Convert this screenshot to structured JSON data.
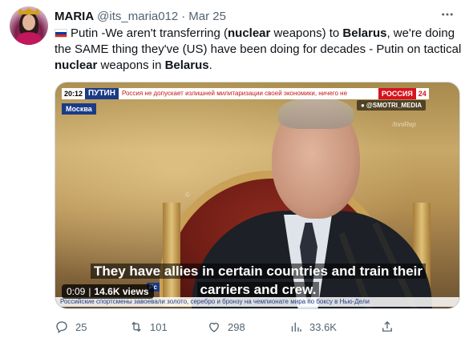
{
  "author": {
    "name": "MARIA",
    "handle": "@its_maria012",
    "separator": "·",
    "date": "Mar 25"
  },
  "tweet": {
    "flag_icon": "russian-flag-icon",
    "segments": [
      "Putin -We aren't transferring (",
      "nuclear",
      " weapons) to ",
      "Belarus",
      ", we're doing the SAME thing they've (US) have been doing for decades - Putin on tactical ",
      "nuclear",
      " weapons in ",
      "Belarus",
      "."
    ]
  },
  "video": {
    "ticker_time": "20:12",
    "ticker_title": "ПУТИН",
    "ticker_text": "Россия не допускает излишней милитаризации своей экономики, ничего не",
    "ticker_channel": "РОССИЯ",
    "ticker_channel_num": "24",
    "watermark": "● @SMOTRI_MEDIA",
    "location": "Москва",
    "side_logo": "/InniRep",
    "center_mark": "©",
    "rc_badge": "Рс",
    "bottom_ticker": "Российские спортсмены завоевали золото, серебро и бронзу на чемпионате мира по боксу в Нью-Дели",
    "caption": "They have allies in certain countries and train their carriers and crew.",
    "timestamp": "0:09",
    "views": "14.6K views"
  },
  "actions": {
    "replies": "25",
    "retweets": "101",
    "likes": "298",
    "views": "33.6K"
  },
  "colors": {
    "text": "#0f1419",
    "secondary": "#536471",
    "border": "#cfd9de"
  }
}
